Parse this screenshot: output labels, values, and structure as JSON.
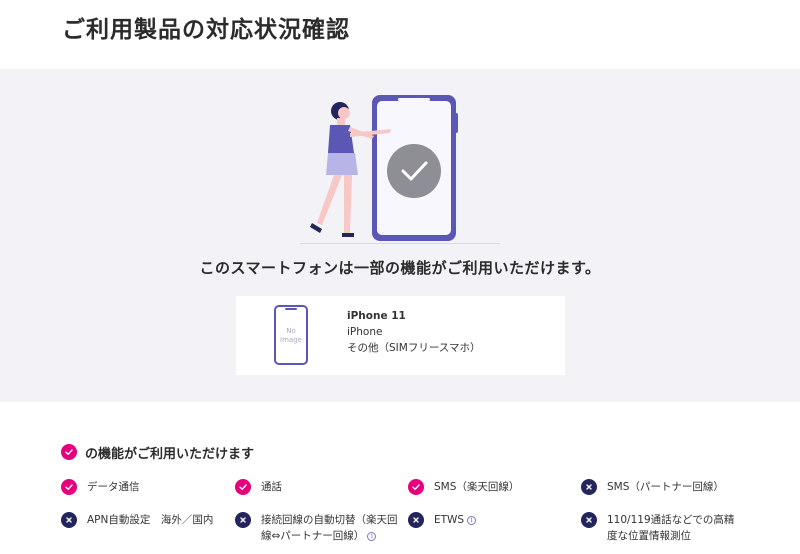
{
  "page": {
    "title": "ご利用製品の対応状況確認"
  },
  "result": {
    "message": "このスマートフォンは一部の機能がご利用いただけます。"
  },
  "device": {
    "thumb_line1": "No",
    "thumb_line2": "Image",
    "model": "iPhone 11",
    "brand": "iPhone",
    "carrier": "その他（SIMフリースマホ）"
  },
  "features": {
    "heading": "の機能がご利用いただけます",
    "items": [
      {
        "label": "データ通信",
        "status": "ok"
      },
      {
        "label": "通話",
        "status": "ok"
      },
      {
        "label": "SMS（楽天回線）",
        "status": "ok"
      },
      {
        "label": "SMS（パートナー回線）",
        "status": "ng"
      },
      {
        "label": "APN自動設定　海外／国内",
        "status": "ng"
      },
      {
        "label": "接続回線の自動切替（楽天回線⇔パートナー回線）",
        "status": "ng",
        "info": "i"
      },
      {
        "label": "ETWS",
        "status": "ng",
        "info": "i"
      },
      {
        "label": "110/119通話などでの高精度な位置情報測位",
        "status": "ng"
      }
    ]
  },
  "colors": {
    "ok": "#e6007e",
    "ng": "#25255e",
    "phone": "#5b57b5",
    "background": "#f2f2f7"
  }
}
